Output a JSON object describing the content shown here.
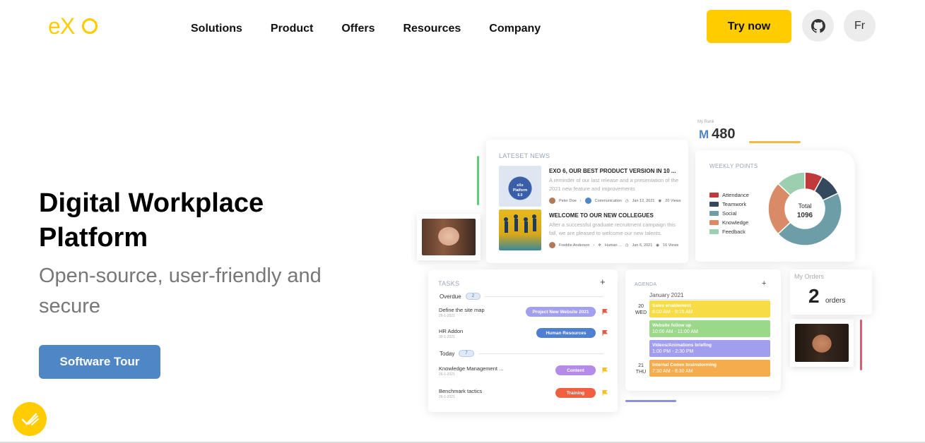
{
  "brand": {
    "logo_text": "eXo",
    "accent": "#ffcc00",
    "primary": "#4f86c6"
  },
  "nav": {
    "items": [
      "Solutions",
      "Product",
      "Offers",
      "Resources",
      "Company"
    ]
  },
  "header": {
    "try_label": "Try now",
    "github_icon": "github-icon",
    "lang_label": "Fr"
  },
  "hero": {
    "title": "Digital Workplace Platform",
    "subtitle": "Open-source, user-friendly and secure",
    "cta": "Software Tour"
  },
  "dashboard": {
    "news": {
      "label": "LATESET NEWS",
      "items": [
        {
          "title": "EXO 6, OUR BEST PRODUCT VERSION IN 10 ...",
          "desc": "A reminder of our last release and a presentation of the 2021 new feature and improvements",
          "author": "Peter Doe",
          "space": "Communication",
          "date": "Jan 12, 2021",
          "views": "20 Views",
          "image_text": "eXo Platform 6.0"
        },
        {
          "title": "WELCOME TO OUR NEW COLLEGUES",
          "desc": "After a successful graduate recruitment campaign this fall, we are pleased to welcome our new talents.",
          "author": "Freddie Anderson",
          "space": "Human ...",
          "date": "Jan 6, 2021",
          "views": "16 Views"
        }
      ]
    },
    "rank": {
      "label": "My Rank",
      "prefix": "M",
      "value": "480"
    },
    "points": {
      "label": "WEEKLY POINTS",
      "total_label": "Total",
      "total_value": "1096",
      "legend": [
        {
          "name": "Attendance",
          "color": "#c0393b",
          "share": 0.08
        },
        {
          "name": "Teamwork",
          "color": "#34495e",
          "share": 0.1
        },
        {
          "name": "Social",
          "color": "#6d9ea8",
          "share": 0.45
        },
        {
          "name": "Knowledge",
          "color": "#d98a66",
          "share": 0.24
        },
        {
          "name": "Feedback",
          "color": "#9ccfb0",
          "share": 0.13
        }
      ]
    },
    "tasks": {
      "label": "TASKS",
      "groups": [
        {
          "name": "Overdue",
          "count": "2"
        },
        {
          "name": "Today",
          "count": "7"
        }
      ],
      "items": [
        {
          "name": "Define the site map",
          "date": "26-1-2021",
          "tag": "Project New Website 2021",
          "tag_color": "#a29ff0",
          "flag": "#e05b4b"
        },
        {
          "name": "HR Addon",
          "date": "30-1-2021",
          "tag": "Human Resources",
          "tag_color": "#4f7fd0",
          "flag": "#e05b4b"
        },
        {
          "name": "Knowledge Management ...",
          "date": "26-1-2021",
          "tag": "Content",
          "tag_color": "#b48be8",
          "flag": "#f4c020"
        },
        {
          "name": "Benchmark tactics",
          "date": "26-1-2021",
          "tag": "Training",
          "tag_color": "#f06040",
          "flag": "#f4c020"
        }
      ]
    },
    "agenda": {
      "label": "AGENDA",
      "month": "January 2021",
      "days": [
        {
          "num": "20",
          "name": "WED"
        },
        {
          "num": "21",
          "name": "THU"
        }
      ],
      "events": [
        {
          "title": "Sales enablement",
          "time": "8:00 AM - 9:15 AM",
          "color": "#f7dc45"
        },
        {
          "title": "Website follow up",
          "time": "10:00 AM - 11:00 AM",
          "color": "#9bd88a"
        },
        {
          "title": "Videos/Animations briefing",
          "time": "1:00 PM - 2:30 PM",
          "color": "#a19ef0"
        },
        {
          "title": "Internal Comm brainstorming",
          "time": "7:30 AM - 8:30 AM",
          "color": "#f5ac4c"
        }
      ]
    },
    "orders": {
      "label": "My Orders",
      "value": "2",
      "unit": "orders"
    }
  }
}
